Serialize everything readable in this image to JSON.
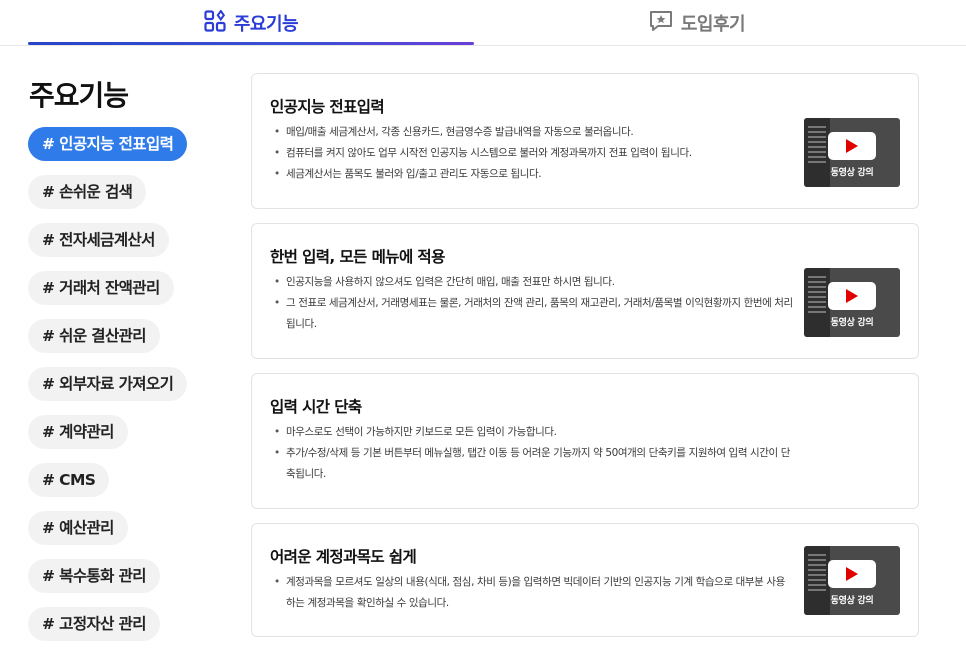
{
  "tabs": {
    "features": {
      "label": "주요기능",
      "icon": "features-grid-icon",
      "active": true
    },
    "reviews": {
      "label": "도입후기",
      "icon": "review-star-icon",
      "active": false
    }
  },
  "sidebar": {
    "title": "주요기능",
    "items": [
      {
        "label": "# 인공지능 전표입력",
        "active": true
      },
      {
        "label": "# 손쉬운 검색"
      },
      {
        "label": "# 전자세금계산서"
      },
      {
        "label": "# 거래처 잔액관리"
      },
      {
        "label": "# 쉬운 결산관리"
      },
      {
        "label": "# 외부자료 가져오기"
      },
      {
        "label": "# 계약관리"
      },
      {
        "label": "# CMS"
      },
      {
        "label": "# 예산관리"
      },
      {
        "label": "# 복수통화 관리"
      },
      {
        "label": "# 고정자산 관리"
      }
    ]
  },
  "cards": [
    {
      "title": "인공지능 전표입력",
      "bullets": [
        "매입/매출 세금계산서, 각종 신용카드, 현금영수증 발급내역을 자동으로 불러옵니다.",
        "컴퓨터를 켜지 않아도 업무 시작전 인공지능 시스템으로 불러와 계정과목까지 전표 입력이 됩니다.",
        "세금계산서는 품목도 불러와 입/출고 관리도 자동으로 됩니다."
      ],
      "video_label": "동영상 강의"
    },
    {
      "title": "한번 입력, 모든 메뉴에 적용",
      "bullets": [
        "인공지능을 사용하지 않으셔도 입력은 간단히 매입, 매출 전표만 하시면 됩니다.",
        "그 전표로 세금계산서, 거래명세표는 물론, 거래처의 잔액 관리, 품목의 재고관리, 거래처/품목별 이익현황까지 한번에 처리됩니다."
      ],
      "video_label": "동영상 강의"
    },
    {
      "title": "입력 시간 단축",
      "bullets": [
        "마우스로도 선택이 가능하지만 키보드로 모든 입력이 가능합니다.",
        "추가/수정/삭제 등 기본 버튼부터 메뉴실행, 탭간 이동 등 어려운 기능까지 약 50여개의 단축키를 지원하여 입력 시간이 단축됩니다."
      ]
    },
    {
      "title": "어려운 계정과목도 쉽게",
      "bullets": [
        "계정과목을 모르셔도 일상의 내용(식대, 점심, 차비 등)을 입력하면 빅데이터 기반의 인공지능 기계 학습으로 대부분 사용하는 계정과목을 확인하실 수 있습니다."
      ],
      "video_label": "동영상 강의"
    }
  ],
  "colors": {
    "accent_blue": "#2b3cd8",
    "chip_active": "#2f7be9",
    "play_red": "#e00000"
  }
}
